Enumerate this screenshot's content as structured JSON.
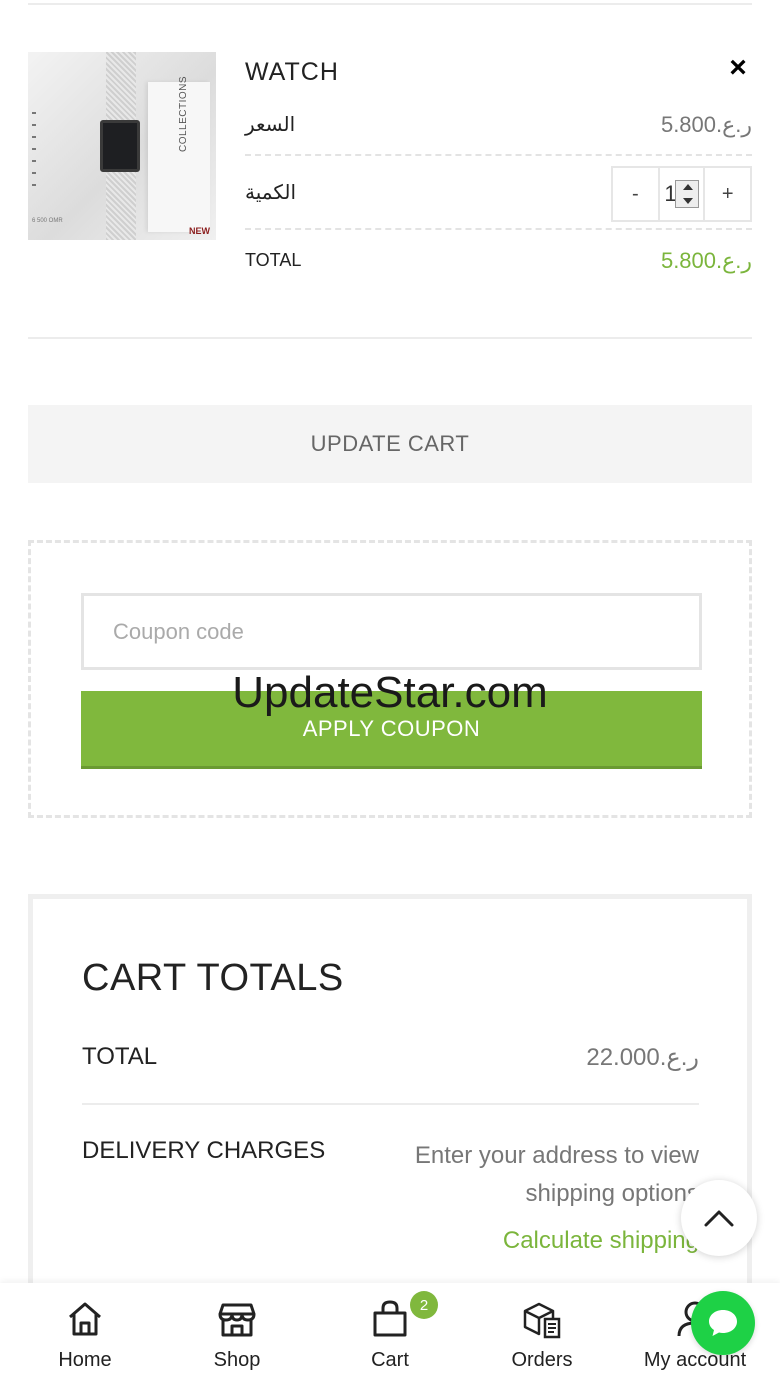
{
  "item": {
    "product_name": "WATCH",
    "remove_symbol": "×",
    "price_label": "السعر",
    "price_value": "5.800.ر.ع",
    "qty_label": "الكمية",
    "qty_value": "1",
    "qty_minus": "-",
    "qty_plus": "+",
    "total_label": "TOTAL",
    "total_value": "5.800.ر.ع",
    "image": {
      "side_text": "COLLECTIONS",
      "new_tag": "NEW",
      "price_tag": "6 500 OMR"
    }
  },
  "update_cart_label": "UPDATE CART",
  "coupon": {
    "placeholder": "Coupon code",
    "apply_label": "APPLY COUPON"
  },
  "watermark": "UpdateStar.com",
  "totals": {
    "heading": "CART TOTALS",
    "total_label": "TOTAL",
    "total_value": "22.000.ر.ع",
    "delivery_label": "DELIVERY CHARGES",
    "delivery_note": "Enter your address to view shipping options",
    "calc_link": "Calculate shipping"
  },
  "nav": {
    "items": [
      {
        "label": "Home",
        "icon": "home-icon"
      },
      {
        "label": "Shop",
        "icon": "shop-icon"
      },
      {
        "label": "Cart",
        "icon": "cart-icon",
        "badge": "2"
      },
      {
        "label": "Orders",
        "icon": "orders-icon"
      },
      {
        "label": "My account",
        "icon": "account-icon"
      }
    ]
  },
  "colors": {
    "accent": "#80b83d",
    "chat": "#1ed146"
  }
}
